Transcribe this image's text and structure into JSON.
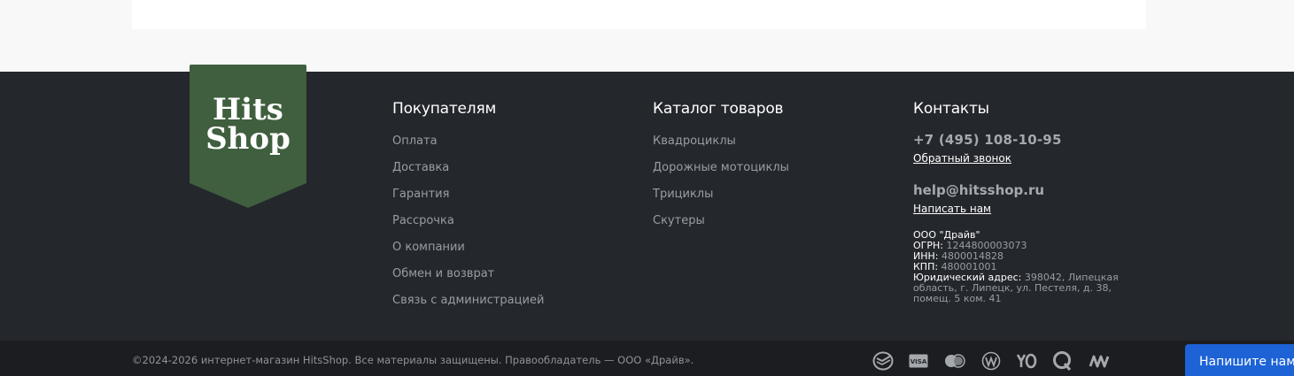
{
  "logo": {
    "line1": "Hits",
    "line2": "Shop",
    "color": "#3f5f3f"
  },
  "columns": {
    "buyers": {
      "title": "Покупателям",
      "links": [
        "Оплата",
        "Доставка",
        "Гарантия",
        "Рассрочка",
        "О компании",
        "Обмен и возврат",
        "Связь с администрацией"
      ]
    },
    "catalog": {
      "title": "Каталог товаров",
      "links": [
        "Квадроциклы",
        "Дорожные мотоциклы",
        "Трициклы",
        "Скутеры"
      ]
    },
    "contacts": {
      "title": "Контакты",
      "phone": "+7 (495) 108-10-95",
      "callback": "Обратный звонок",
      "email": "help@hitsshop.ru",
      "write_us": "Написать нам",
      "company_name": "ООО \"Драйв\"",
      "ogrn_label": "ОГРН:",
      "ogrn": "1244800003073",
      "inn_label": "ИНН:",
      "inn": "4800014828",
      "kpp_label": "КПП:",
      "kpp": "480001001",
      "address_label": "Юридический адрес:",
      "address": "398042, Липецкая область, г. Липецк, ул. Пестеля, д. 38, помещ. 5 ком. 41"
    }
  },
  "copyright": "©2024-2026 интернет-магазин HitsShop. Все материалы защищены. Правообладатель — ООО «Драйв».",
  "payment_icons": [
    "sberbank-icon",
    "visa-icon",
    "mastercard-icon",
    "mir-icon",
    "yoomoney-icon",
    "qiwi-icon",
    "webmoney-icon"
  ],
  "payment_visa_text": "VISA",
  "chat_button": "Напишите нам, мы онлайн!",
  "colors": {
    "footer_bg": "#24272c",
    "bottom_bg": "#1b1d21",
    "chat_blue": "#1d63d6",
    "link_gray": "#9a9da2"
  }
}
